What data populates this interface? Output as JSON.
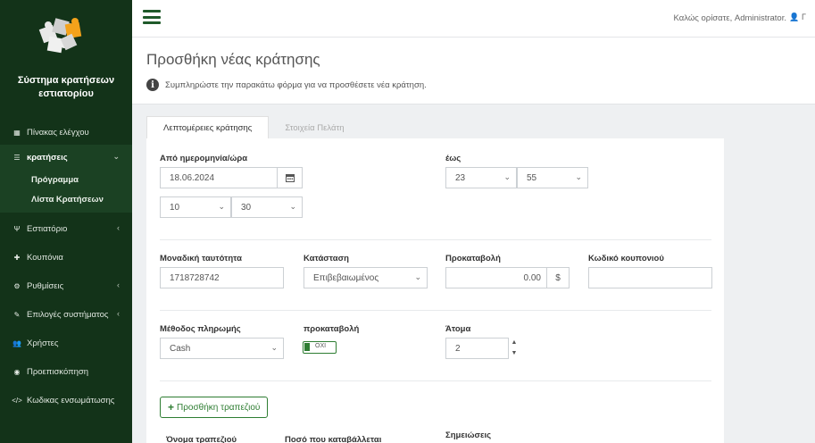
{
  "sidebar": {
    "brand_line1": "Σύστημα κρατήσεων",
    "brand_line2": "εστιατορίου",
    "items": [
      {
        "label": "Πίνακας ελέγχου",
        "icon": "dashboard-icon"
      },
      {
        "label": "κρατήσεις",
        "icon": "list-icon"
      },
      {
        "label": "Πρόγραμμα"
      },
      {
        "label": "Λίστα Κρατήσεων"
      },
      {
        "label": "Εστιατόριο",
        "icon": "restaurant-icon"
      },
      {
        "label": "Κουπόνια",
        "icon": "gift-icon"
      },
      {
        "label": "Ρυθμίσεις",
        "icon": "cogs-icon"
      },
      {
        "label": "Επιλογές συστήματος",
        "icon": "wrench-icon"
      },
      {
        "label": "Χρήστες",
        "icon": "users-icon"
      },
      {
        "label": "Προεπισκόπηση",
        "icon": "eye-icon"
      },
      {
        "label": "Κωδικας ενσωμάτωσης",
        "icon": "code-icon"
      }
    ]
  },
  "topbar": {
    "welcome": "Καλώς ορίσατε, Administrator.",
    "user_initial": "Γ"
  },
  "header": {
    "title": "Προσθήκη νέας κράτησης",
    "hint": "Συμπληρώστε την παρακάτω φόρμα για να προσθέσετε νέα κράτηση."
  },
  "tabs": [
    {
      "label": "Λεπτομέρειες κράτησης",
      "active": true
    },
    {
      "label": "Στοιχεία Πελάτη",
      "active": false
    }
  ],
  "form": {
    "from_label": "Από ημερομηνία/ώρα",
    "date_value": "18.06.2024",
    "from_hour": "10",
    "from_min": "30",
    "to_label": "έως",
    "to_hour": "23",
    "to_min": "55",
    "id_label": "Μοναδική ταυτότητα",
    "id_value": "1718728742",
    "status_label": "Κατάσταση",
    "status_value": "Επιβεβαιωμένος",
    "deposit_label": "Προκαταβολή",
    "deposit_value": "0.00",
    "currency": "$",
    "coupon_label": "Κωδικό κουπονιού",
    "coupon_value": "",
    "payment_label": "Μέθοδος πληρωμής",
    "payment_value": "Cash",
    "prepay_label": "προκαταβολή",
    "prepay_toggle": "ΟΧΙ",
    "people_label": "Άτομα",
    "people_value": "2",
    "add_table_button": "Προσθήκη τραπεζιού",
    "table_name_col": "Όνομα τραπεζιού",
    "amount_col": "Ποσό που καταβάλλεται",
    "notes_label": "Σημειώσεις"
  },
  "colors": {
    "sidebar_bg": "#133319",
    "accent": "#2e7d32"
  }
}
